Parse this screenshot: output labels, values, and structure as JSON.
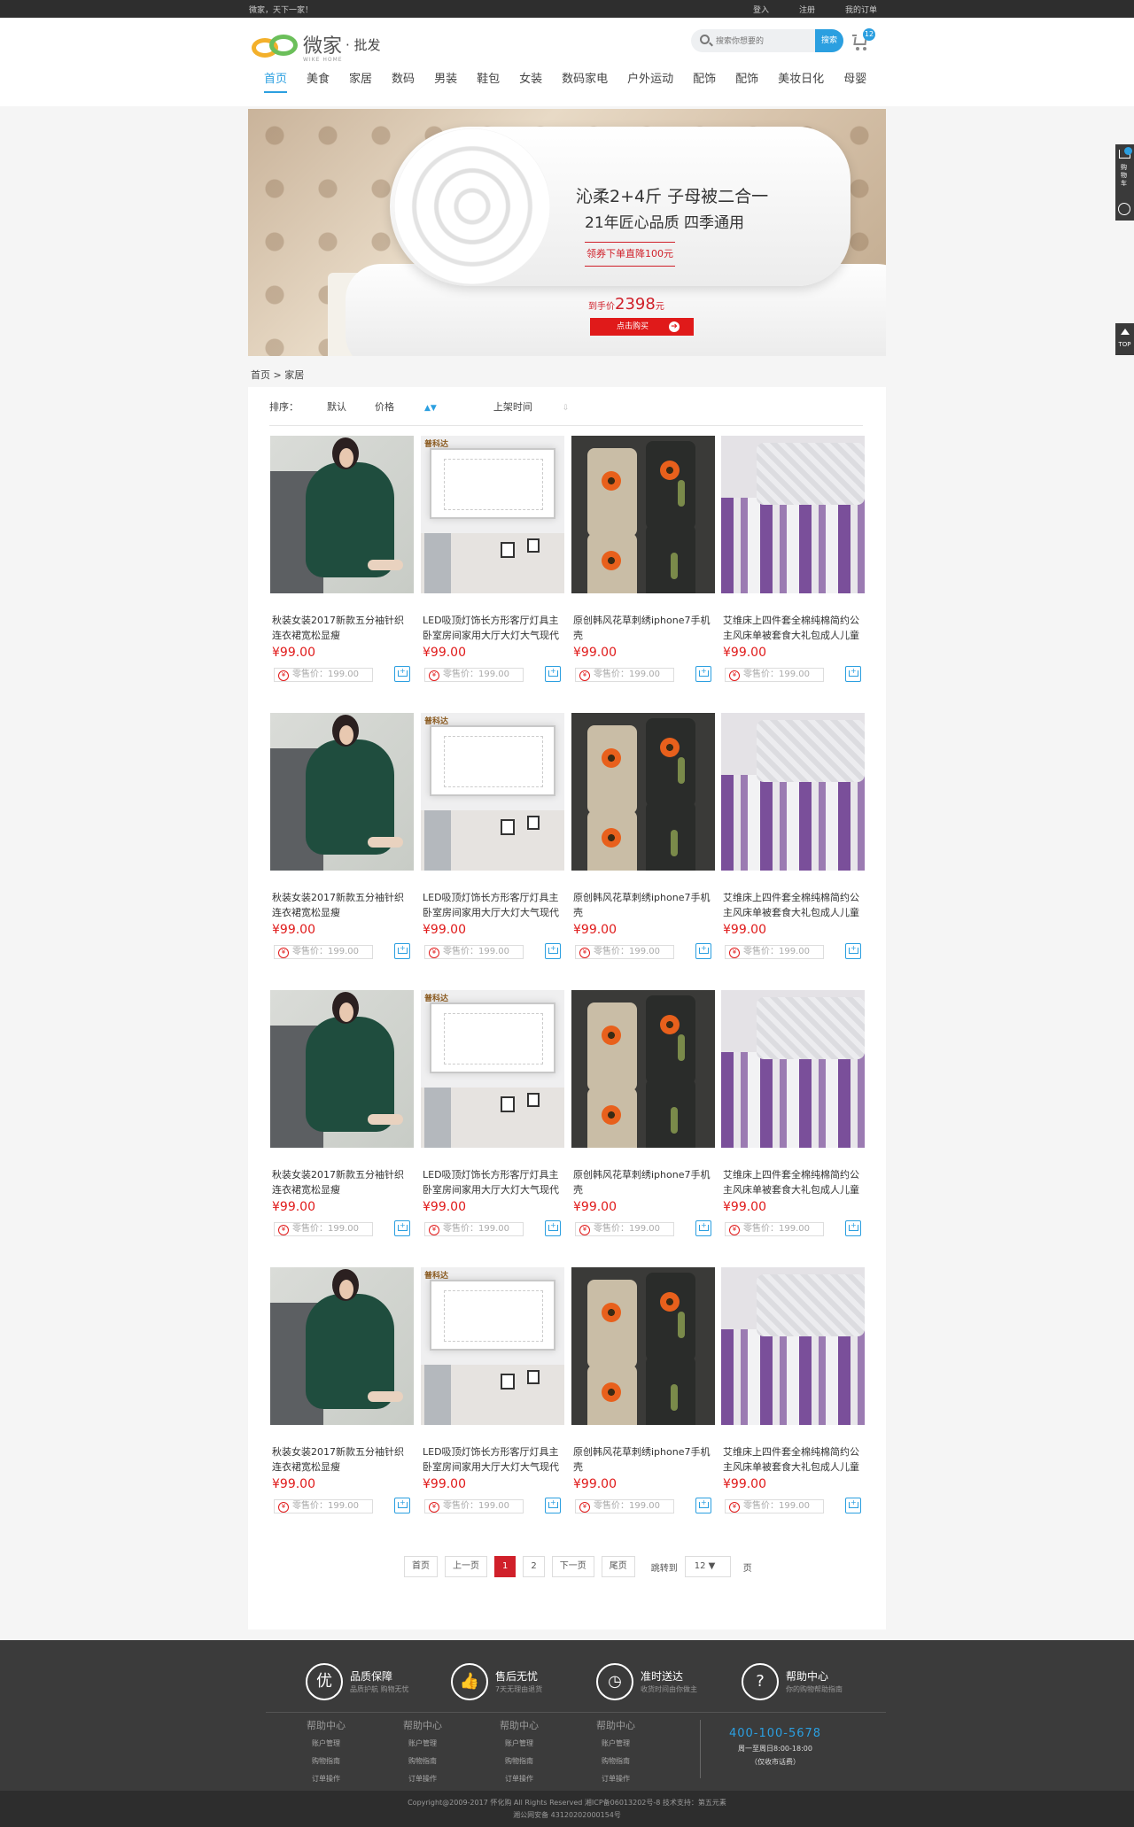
{
  "topbar": {
    "welcome": "微家，天下一家！",
    "login": "登入",
    "register": "注册",
    "orders": "我的订单"
  },
  "logo": {
    "name": "微家",
    "suffix": "· 批发",
    "en": "WIKE HOME"
  },
  "search": {
    "placeholder": "搜索你想要的",
    "button": "搜索"
  },
  "cart": {
    "count": "12"
  },
  "nav": [
    "首页",
    "美食",
    "家居",
    "数码",
    "男装",
    "鞋包",
    "女装",
    "数码家电",
    "户外运动",
    "配饰",
    "配饰",
    "美妆日化",
    "母婴"
  ],
  "banner": {
    "line1": "沁柔2+4斤  子母被二合一",
    "line2": "21年匠心品质  四季通用",
    "coupon": "领券下单直降100元",
    "price_label": "到手价",
    "price": "2398",
    "price_unit": "元",
    "buy": "点击购买",
    "buy_arrow": "➔"
  },
  "breadcrumb": "首页 > 家居",
  "sort": {
    "label": "排序：",
    "default": "默认",
    "price": "价格",
    "price_arrow": "▲▼",
    "time": "上架时间",
    "time_arrow": "⇩"
  },
  "products": [
    {
      "title": "秋装女装2017新款五分袖针织连衣裙宽松显瘦",
      "price": "¥99.00",
      "retail": "零售价：199.00",
      "img": "dress"
    },
    {
      "title": "LED吸顶灯饰长方形客厅灯具主卧室房间家用大厅大灯大气现代简约",
      "price": "¥99.00",
      "retail": "零售价：199.00",
      "img": "lamp",
      "brand": "普科达"
    },
    {
      "title": "原创韩风花草刺绣iphone7手机壳",
      "price": "¥99.00",
      "retail": "零售价：199.00",
      "img": "phone"
    },
    {
      "title": "艾维床上四件套全棉纯棉简约公主风床单被套食大礼包成人儿童款",
      "price": "¥99.00",
      "retail": "零售价：199.00",
      "img": "bed"
    }
  ],
  "pagination": {
    "first": "首页",
    "prev": "上一页",
    "p1": "1",
    "p2": "2",
    "next": "下一页",
    "last": "尾页",
    "jump": "跳转到",
    "jump_value": "12 ▼",
    "page": "页"
  },
  "features": [
    {
      "icon": "优",
      "title": "品质保障",
      "sub": "品质护航 购物无忧"
    },
    {
      "icon": "👍",
      "title": "售后无忧",
      "sub": "7天无理由退货"
    },
    {
      "icon": "◷",
      "title": "准时送达",
      "sub": "收货时间由你做主"
    },
    {
      "icon": "?",
      "title": "帮助中心",
      "sub": "你的购物帮助指南"
    }
  ],
  "footer_cols": [
    {
      "head": "帮助中心",
      "items": [
        "账户管理",
        "购物指南",
        "订单操作"
      ]
    },
    {
      "head": "帮助中心",
      "items": [
        "账户管理",
        "购物指南",
        "订单操作"
      ]
    },
    {
      "head": "帮助中心",
      "items": [
        "账户管理",
        "购物指南",
        "订单操作"
      ]
    },
    {
      "head": "帮助中心",
      "items": [
        "账户管理",
        "购物指南",
        "订单操作"
      ]
    }
  ],
  "contact": {
    "tel": "400-100-5678",
    "hours": "周一至周日8:00-18:00",
    "note": "（仅收市话费）"
  },
  "copyright": {
    "line1": "Copyright@2009-2017 怀化购  All Rights Reserved  湘ICP备06013202号-8   技术支持：第五元素",
    "line2": "湘公网安备 43120202000154号"
  },
  "sidebar": {
    "cart_label": "购物车",
    "cart_count": "12",
    "top": "TOP"
  }
}
